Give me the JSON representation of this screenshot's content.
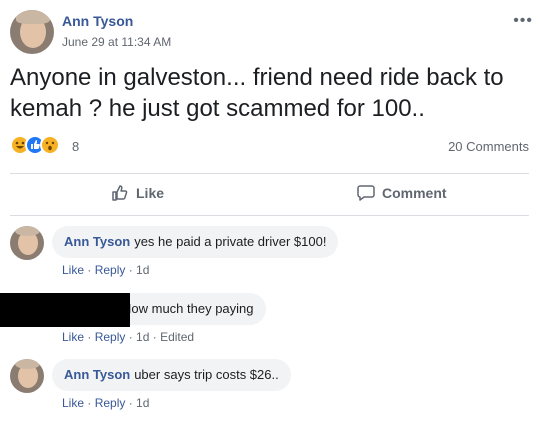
{
  "post": {
    "author": "Ann Tyson",
    "timestamp": "June 29 at 11:34 AM",
    "more_icon": "more-horizontal-icon",
    "text": "Anyone in galveston... friend need ride back to kemah ? he just got scammed for 100..",
    "reactions": {
      "icons": [
        "haha-icon",
        "like-icon",
        "wow-icon"
      ],
      "count": "8"
    },
    "comment_count": "20 Comments"
  },
  "actions": {
    "like": "Like",
    "comment": "Comment"
  },
  "comments": [
    {
      "name": "Ann Tyson",
      "text": "yes he paid a private driver $100!",
      "like": "Like",
      "reply": "Reply",
      "time": "1d",
      "edited": ""
    },
    {
      "name": "",
      "text": "How much they paying",
      "like": "Like",
      "reply": "Reply",
      "time": "1d",
      "edited": "Edited"
    },
    {
      "name": "Ann Tyson",
      "text": "uber says trip costs $26..",
      "like": "Like",
      "reply": "Reply",
      "time": "1d",
      "edited": ""
    }
  ],
  "colors": {
    "link": "#385898",
    "meta": "#606770",
    "bubble": "#f2f3f5",
    "like_blue": "#2078f4",
    "emoji_yellow": "#f7b125"
  }
}
